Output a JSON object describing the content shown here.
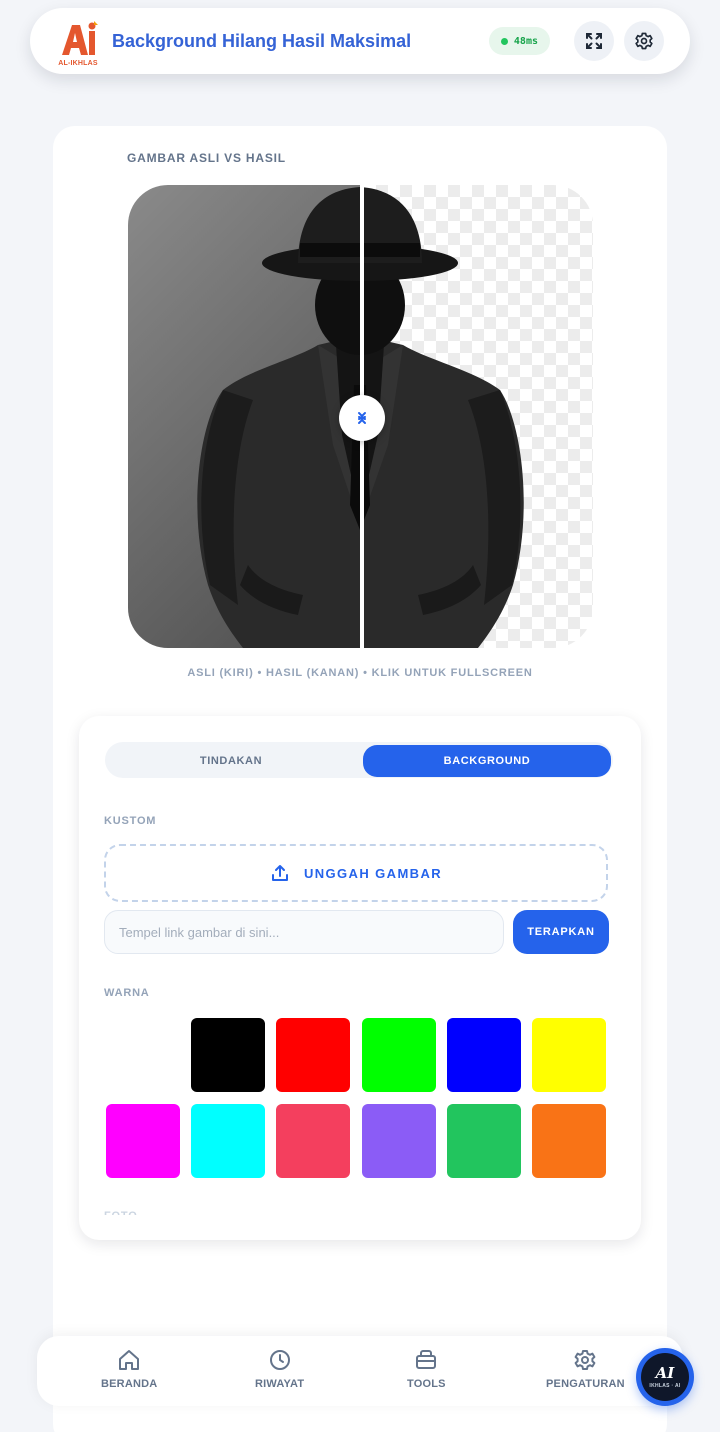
{
  "header": {
    "logo_text": "AI",
    "logo_sub": "AL-IKHLAS",
    "title": "Background Hilang Hasil Maksimal",
    "latency": "48ms",
    "fullscreen_icon": "expand-icon",
    "settings_icon": "gear-icon"
  },
  "preview": {
    "section_label": "GAMBAR ASLI VS HASIL",
    "caption": "ASLI (KIRI) • HASIL (KANAN) • KLIK UNTUK FULLSCREEN"
  },
  "panel": {
    "tabs": [
      {
        "label": "TINDAKAN",
        "active": false
      },
      {
        "label": "BACKGROUND",
        "active": true
      }
    ],
    "custom_label": "KUSTOM",
    "upload_label": "UNGGAH GAMBAR",
    "url_placeholder": "Tempel link gambar di sini...",
    "apply_label": "TERAPKAN",
    "color_label": "WARNA",
    "colors": [
      "#ffffff",
      "#000000",
      "#ff0000",
      "#00ff00",
      "#0000ff",
      "#ffff00",
      "#ff00ff",
      "#00ffff",
      "#f43f5e",
      "#8b5cf6",
      "#22c55e",
      "#f97316"
    ]
  },
  "nav": {
    "items": [
      {
        "label": "BERANDA",
        "icon": "home-icon"
      },
      {
        "label": "RIWAYAT",
        "icon": "clock-icon"
      },
      {
        "label": "TOOLS",
        "icon": "toolbox-icon"
      },
      {
        "label": "PENGATURAN",
        "icon": "gear-icon"
      }
    ],
    "fab_logo": "AI",
    "fab_sub": "IKHLAS · AI"
  },
  "theme": {
    "accent": "#2563eb",
    "title_color": "#3563d6",
    "logo_color": "#e4572e"
  }
}
